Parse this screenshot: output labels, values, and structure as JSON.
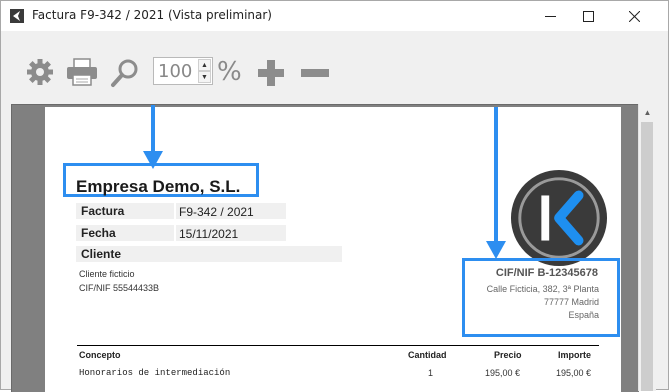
{
  "window": {
    "title": "Factura F9-342 / 2021 (Vista preliminar)"
  },
  "toolbar": {
    "zoom_value": "100",
    "percent_symbol": "%"
  },
  "document": {
    "company_name": "Empresa Demo, S.L.",
    "invoice_label": "Factura",
    "invoice_value": "F9-342 / 2021",
    "date_label": "Fecha",
    "date_value": "15/11/2021",
    "client_label": "Cliente",
    "client_name": "Cliente ficticio",
    "client_cif": "CIF/NIF 55544433B",
    "issuer_cif": "CIF/NIF B-12345678",
    "issuer_address_1": "Calle Ficticia, 382, 3ª Planta",
    "issuer_address_2": "77777 Madrid",
    "issuer_country": "España",
    "table": {
      "headers": [
        "Concepto",
        "Cantidad",
        "Precio",
        "Importe"
      ],
      "rows": [
        [
          "Honorarios de intermediación",
          "1",
          "195,00 €",
          "195,00 €"
        ]
      ]
    }
  },
  "colors": {
    "highlight": "#2d8ef0",
    "logo_dark": "#3a3a3a",
    "logo_accent": "#1e8ff0"
  }
}
